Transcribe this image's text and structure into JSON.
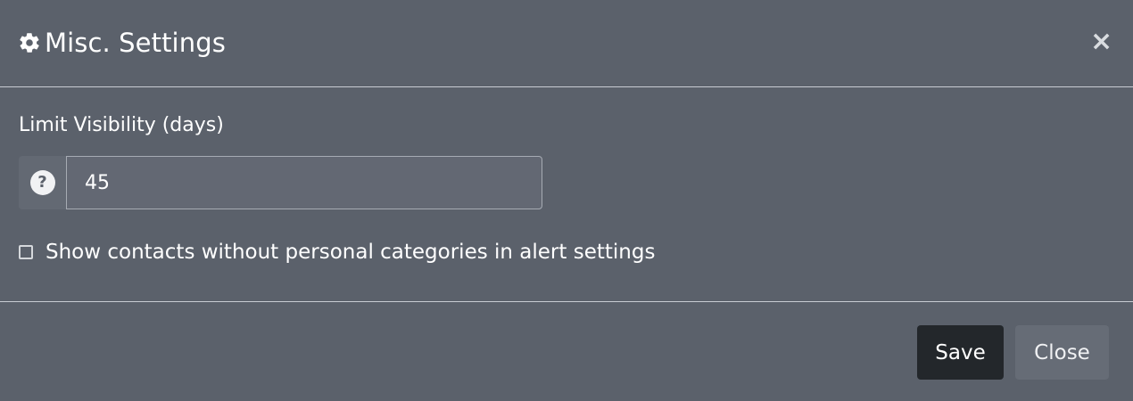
{
  "header": {
    "title": "Misc. Settings",
    "icon": "gear-icon",
    "close_icon": "close-icon",
    "close_glyph": "×"
  },
  "body": {
    "limit_label": "Limit Visibility (days)",
    "help_glyph": "?",
    "limit_value": "45",
    "checkbox_label": "Show contacts without personal categories in alert settings",
    "checkbox_checked": false
  },
  "footer": {
    "save_label": "Save",
    "close_label": "Close"
  },
  "colors": {
    "background": "#5b616b",
    "save_button": "#23272b",
    "close_button": "#666c76"
  }
}
